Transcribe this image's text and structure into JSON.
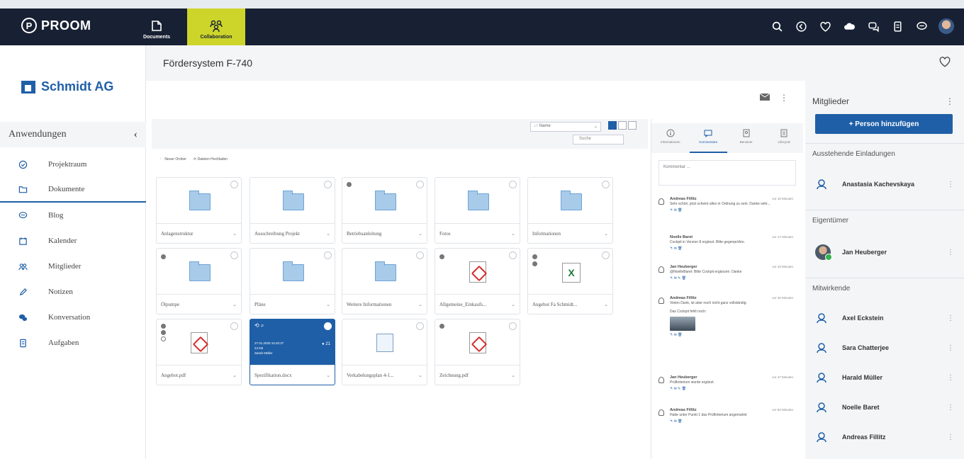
{
  "app": {
    "name": "PROOM",
    "nav_documents": "Documents",
    "nav_collaboration": "Collaboration"
  },
  "sidebar": {
    "company": "Schmidt AG",
    "apps_header": "Anwendungen",
    "items": [
      {
        "label": "Projektraum",
        "icon": "check-circle-icon"
      },
      {
        "label": "Dokumente",
        "icon": "folder-icon"
      },
      {
        "label": "Blog",
        "icon": "chat-bubble-icon"
      },
      {
        "label": "Kalender",
        "icon": "calendar-icon"
      },
      {
        "label": "Mitglieder",
        "icon": "users-icon"
      },
      {
        "label": "Notizen",
        "icon": "pencil-icon"
      },
      {
        "label": "Konversation",
        "icon": "conversation-icon"
      },
      {
        "label": "Aufgaben",
        "icon": "clipboard-icon"
      }
    ]
  },
  "page": {
    "title": "Fördersystem F-740"
  },
  "toolbar": {
    "sort_value": "↓↑ Name",
    "search_placeholder": "Suche",
    "new_folder": "Neuer Ordner",
    "upload": "Dateien Hochladen"
  },
  "files": [
    {
      "name": "Anlagenstruktur",
      "type": "folder"
    },
    {
      "name": "Ausschreibung Projekt",
      "type": "folder"
    },
    {
      "name": "Betriebsanleitung",
      "type": "folder"
    },
    {
      "name": "Fotos",
      "type": "folder"
    },
    {
      "name": "Informationen",
      "type": "folder"
    },
    {
      "name": "Ölpumpe",
      "type": "folder"
    },
    {
      "name": "Pläne",
      "type": "folder"
    },
    {
      "name": "Weitere Informationen",
      "type": "folder"
    },
    {
      "name": "Allgemeine_Einkaufs...",
      "type": "pdf"
    },
    {
      "name": "Angebot Fa Schmidt...",
      "type": "xls"
    },
    {
      "name": "Angebot.pdf",
      "type": "pdf"
    },
    {
      "name": "Spezifikation.docx",
      "type": "selected"
    },
    {
      "name": "Verkabelungsplan 4-1...",
      "type": "image"
    },
    {
      "name": "Zeichnung.pdf",
      "type": "pdf"
    }
  ],
  "selected_file": {
    "line1": "27.01.2020 10:40:37",
    "line2": "24 KB",
    "line3": "Sarah Müller",
    "count": "21"
  },
  "comments_panel": {
    "tabs": [
      "Informationen",
      "Kommentare",
      "Benutzer",
      "Lifecycle"
    ],
    "input_placeholder": "Kommentar ...",
    "comments": [
      {
        "author": "Andreas Fillitz",
        "time": "vor 16 Minuten",
        "text": "Sehr schön, jetzt scheint alles in Ordnung zu sein. Danke sehr..."
      },
      {
        "author": "Noelle Baret",
        "time": "vor 17 Minuten",
        "text": "Cockpit in Version 8 ergänzt. Bitte gegenprüfen."
      },
      {
        "author": "Jan Heuberger",
        "time": "vor 18 Minuten",
        "text": "@NoelleBaret: Bitte Cockpit ergänzen. Danke"
      },
      {
        "author": "Andreas Fillitz",
        "time": "vor 40 Minuten",
        "text": "Vielen Dank, ist aber noch nicht ganz vollständig.",
        "extra": "Das Cockpit fehlt noch:"
      },
      {
        "author": "Jan Heuberger",
        "time": "vor 47 Minuten",
        "text": "Prüfkriterium wurde ergänzt."
      },
      {
        "author": "Andreas Fillitz",
        "time": "vor 50 Minuten",
        "text": "Hatte unter Punkt 1 das Prüfkriterium angemahnt"
      }
    ]
  },
  "members_panel": {
    "header": "Mitglieder",
    "add_button": "+ Person hinzufügen",
    "pending_label": "Ausstehende Einladungen",
    "pending": [
      "Anastasia Kachevskaya"
    ],
    "owner_label": "Eigentümer",
    "owner": "Jan Heuberger",
    "contributors_label": "Mitwirkende",
    "contributors": [
      "Axel Eckstein",
      "Sara Chatterjee",
      "Harald Müller",
      "Noelle Baret",
      "Andreas Fillitz"
    ]
  }
}
